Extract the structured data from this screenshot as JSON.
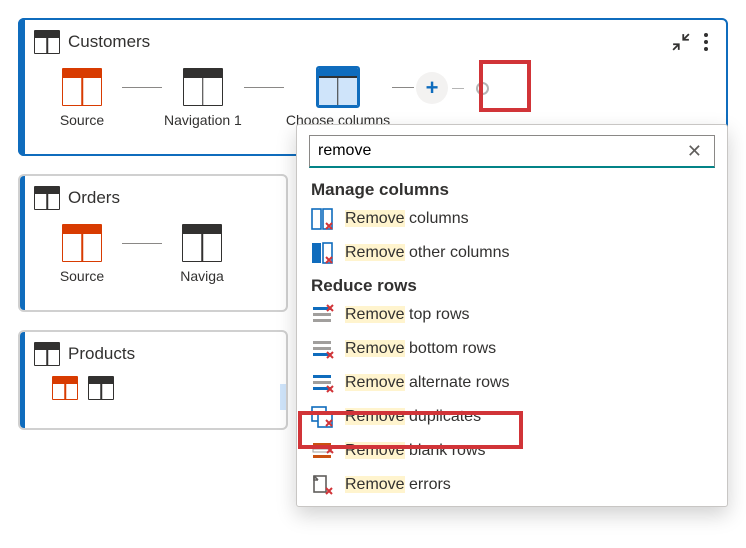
{
  "queries": {
    "customers": {
      "title": "Customers",
      "steps": [
        {
          "label": "Source"
        },
        {
          "label": "Navigation 1"
        },
        {
          "label": "Choose columns"
        }
      ]
    },
    "orders": {
      "title": "Orders",
      "steps": [
        {
          "label": "Source"
        },
        {
          "label": "Naviga"
        }
      ]
    },
    "products": {
      "title": "Products"
    }
  },
  "dropdown": {
    "search_value": "remove",
    "groups": [
      {
        "title": "Manage columns",
        "items": [
          {
            "hl": "Remove",
            "rest": " columns",
            "icon": "remove-columns"
          },
          {
            "hl": "Remove",
            "rest": " other columns",
            "icon": "remove-other-columns"
          }
        ]
      },
      {
        "title": "Reduce rows",
        "items": [
          {
            "hl": "Remove",
            "rest": " top rows",
            "icon": "remove-top-rows"
          },
          {
            "hl": "Remove",
            "rest": " bottom rows",
            "icon": "remove-bottom-rows"
          },
          {
            "hl": "Remove",
            "rest": " alternate rows",
            "icon": "remove-alternate-rows"
          },
          {
            "hl": "Remove",
            "rest": " duplicates",
            "icon": "remove-duplicates"
          },
          {
            "hl": "Remove",
            "rest": " blank rows",
            "icon": "remove-blank-rows"
          },
          {
            "hl": "Remove",
            "rest": " errors",
            "icon": "remove-errors"
          }
        ]
      }
    ]
  }
}
